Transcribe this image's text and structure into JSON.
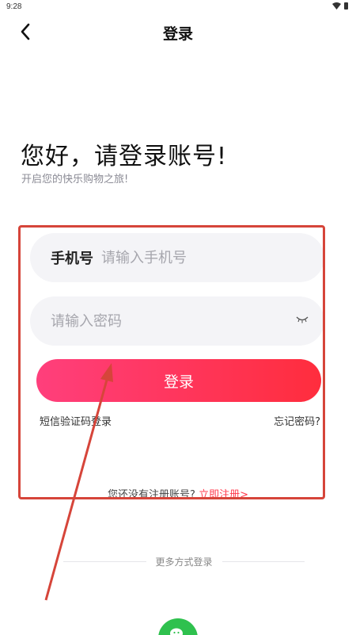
{
  "status_bar": {
    "time": "9:28"
  },
  "nav": {
    "title": "登录"
  },
  "greeting": {
    "title": "您好，请登录账号!",
    "subtitle": "开启您的快乐购物之旅!"
  },
  "form": {
    "phone_label": "手机号",
    "phone_placeholder": "请输入手机号",
    "password_placeholder": "请输入密码",
    "login_label": "登录",
    "sms_login": "短信验证码登录",
    "forgot_password": "忘记密码?",
    "register_prompt": "您还没有注册账号?",
    "register_link": "立即注册>"
  },
  "more": {
    "label": "更多方式登录"
  },
  "colors": {
    "accent_start": "#ff3f7c",
    "accent_end": "#ff2d3d",
    "link": "#ff3a4c",
    "annotation": "#d6453a",
    "wechat": "#2fc14e"
  },
  "icons": {
    "back": "chevron-left-icon",
    "eye": "eye-closed-icon",
    "wechat": "wechat-icon"
  }
}
